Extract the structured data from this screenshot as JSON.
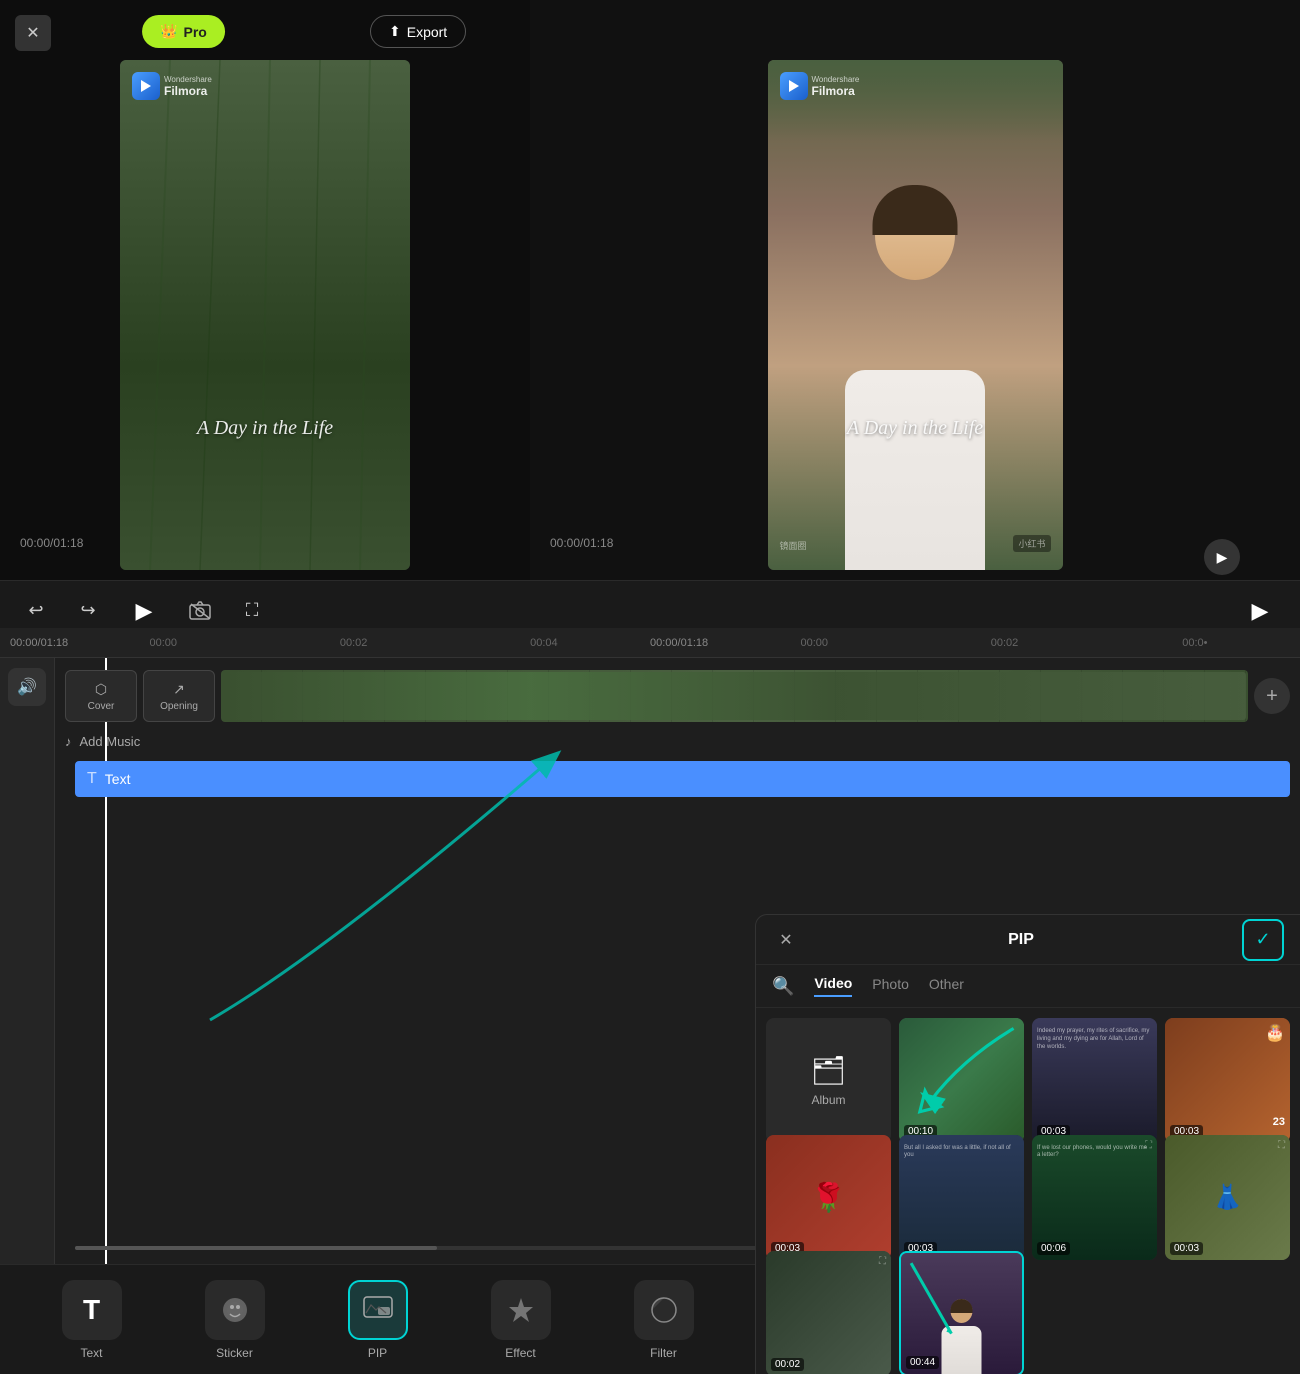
{
  "app": {
    "title": "Filmora",
    "close_icon": "✕"
  },
  "header": {
    "pro_label": "Pro",
    "pro_icon": "👑",
    "export_label": "Export",
    "export_icon": "⬆"
  },
  "preview_left": {
    "title": "A Day in the Life",
    "time_current": "00:00",
    "time_total": "01:18",
    "watermark": "Wondershare\nFilmora"
  },
  "preview_right": {
    "title": "A Day in the Life",
    "time_current": "00:00",
    "time_total": "01:18",
    "watermark_left": "镜面圈",
    "watermark_right": "小红书"
  },
  "controls": {
    "undo_icon": "↩",
    "redo_icon": "↪",
    "play_icon": "▶",
    "camera_icon": "📷",
    "fullscreen_icon": "⛶"
  },
  "timeline": {
    "ruler": [
      "00:00",
      "00:02",
      "00:04",
      "00:00/01:18",
      "00:00",
      "00:02"
    ],
    "left_time": "00:00/01:18",
    "right_time": "00:00/01:18",
    "cover_label": "Cover",
    "opening_label": "Opening",
    "add_music_label": "Add Music",
    "text_label": "Text"
  },
  "toolbar": {
    "items": [
      {
        "id": "text",
        "label": "Text",
        "icon": "T"
      },
      {
        "id": "sticker",
        "label": "Sticker",
        "icon": "●"
      },
      {
        "id": "pip",
        "label": "PIP",
        "icon": "🖼"
      },
      {
        "id": "effect",
        "label": "Effect",
        "icon": "✦"
      },
      {
        "id": "filter",
        "label": "Filter",
        "icon": "◑"
      }
    ]
  },
  "pip": {
    "title": "PIP",
    "close_icon": "✕",
    "confirm_icon": "✓",
    "search_icon": "🔍",
    "tabs": [
      {
        "id": "video",
        "label": "Video",
        "active": true
      },
      {
        "id": "photo",
        "label": "Photo",
        "active": false
      },
      {
        "id": "other",
        "label": "Other",
        "active": false
      }
    ],
    "album_label": "Album",
    "items": [
      {
        "id": 1,
        "duration": "00:10",
        "bg": "thumb-bg-1",
        "selected": false
      },
      {
        "id": 2,
        "duration": "00:03",
        "bg": "thumb-bg-2",
        "selected": false
      },
      {
        "id": 3,
        "duration": "00:03",
        "bg": "thumb-bg-3",
        "selected": false
      },
      {
        "id": 4,
        "duration": "00:03",
        "bg": "thumb-bg-4",
        "selected": false
      },
      {
        "id": 5,
        "duration": "00:03",
        "bg": "thumb-bg-5",
        "selected": false
      },
      {
        "id": 6,
        "duration": "00:06",
        "bg": "thumb-bg-6",
        "selected": false
      },
      {
        "id": 7,
        "duration": "00:03",
        "bg": "thumb-bg-7",
        "selected": false
      },
      {
        "id": 8,
        "duration": "00:02",
        "bg": "thumb-bg-8",
        "selected": false
      },
      {
        "id": 9,
        "duration": "00:44",
        "bg": "thumb-bg-9",
        "selected": true
      }
    ]
  }
}
